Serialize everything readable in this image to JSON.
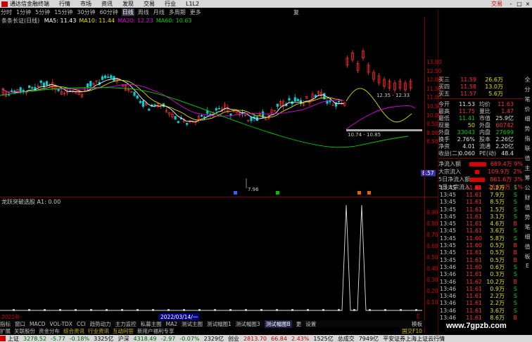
{
  "menubar": {
    "app_title": "通达信金融终端",
    "items": [
      "行情",
      "市场",
      "资讯",
      "发现",
      "交易",
      "行业",
      "L1L2"
    ],
    "trade_label": "交易",
    "window_buttons": [
      "-",
      "□",
      "×"
    ]
  },
  "periodbar": {
    "tabs": [
      "分时",
      "1分钟",
      "5分钟",
      "15分钟",
      "30分钟",
      "60分钟",
      "日线",
      "周线",
      "月线",
      "多周期",
      "更多"
    ],
    "selected": "日线",
    "right_label": "复"
  },
  "ma_legend": {
    "title": "条条长证(日线)",
    "items": [
      {
        "label": "MA5: 11.43",
        "color": "#ffffff"
      },
      {
        "label": "MA10: 11.44",
        "color": "#e0e000"
      },
      {
        "label": "MA20: 12.23",
        "color": "#e000e0"
      },
      {
        "label": "MA60: 10.63",
        "color": "#00d000"
      }
    ]
  },
  "main_chart": {
    "annotations": {
      "high": "12.35 - 12.33",
      "mid": "10.74 - 10.85",
      "low": "7.96"
    },
    "price_label": "8.57"
  },
  "price_axis": [
    "13.00",
    "12.50",
    "12.00",
    "11.50",
    "11.00",
    "10.50",
    "10.00",
    "9.50",
    "9.00",
    "8.50"
  ],
  "sub_chart": {
    "title": "龙跃突破选股 A1: 0.00"
  },
  "sub_axis": [
    "0.90",
    "0.80",
    "0.70",
    "0.60",
    "0.50",
    "0.40",
    "0.30",
    "0.20",
    "0.10"
  ],
  "date_row": {
    "start": "2021年",
    "cursor_date": "2022/03/14/一",
    "marker": "E"
  },
  "indicator_tabs": [
    "指标",
    "窗口",
    "MACD",
    "VOL-TDX",
    "CCI",
    "趋势动力",
    "主力监控",
    "私募主图",
    "MA2",
    "测试主图",
    "测试幅图1",
    "测试幅图3",
    "测试幅图B",
    "更",
    "设置"
  ],
  "indicator_selected": "测试幅图B",
  "indicator_right": "模板",
  "bottom_tabs": [
    "扩展",
    "关联股份",
    "资金分布",
    "综合资讯",
    "行业资讯",
    "互动问答",
    "新用户福利专享"
  ],
  "bottom_highlight": [
    "综合资讯",
    "行业资讯",
    "互动问答"
  ],
  "bottom_tag": "国交F10",
  "quote": {
    "rows": [
      {
        "l": "买三",
        "v1": "11.59",
        "c1": "r",
        "v2": "26.6万",
        "c2": "y"
      },
      {
        "l": "买四",
        "v1": "11.58",
        "c1": "r",
        "v2": "13.0万",
        "c2": "y"
      },
      {
        "l": "买五",
        "v1": "11.57",
        "c1": "r",
        "v2": "5.6万",
        "c2": "y"
      }
    ],
    "stats": [
      {
        "l": "今开",
        "v1": "11.53",
        "c1": "w",
        "l2": "均价",
        "v2": "11.63",
        "c2": "r"
      },
      {
        "l": "最高",
        "v1": "11.75",
        "c1": "r",
        "l2": "量比",
        "v2": "1.47",
        "c2": "r"
      },
      {
        "l": "最低",
        "v1": "11.41",
        "c1": "g",
        "l2": "市值",
        "v2": "25.9亿",
        "c2": "w"
      },
      {
        "l": "现量",
        "v1": "50",
        "c1": "y",
        "l2": "外盘",
        "v2": "60742",
        "c2": "r"
      },
      {
        "l": "外盘",
        "v1": "33043",
        "c1": "g",
        "l2": "内盘",
        "v2": "27699",
        "c2": "g"
      },
      {
        "l": "换手",
        "v1": "2.76%",
        "c1": "w",
        "l2": "股本",
        "v2": "2.26亿",
        "c2": "w"
      },
      {
        "l": "净资",
        "v1": "4.01",
        "c1": "w",
        "l2": "流通",
        "v2": "2.20亿",
        "c2": "w"
      },
      {
        "l": "收益(二)",
        "v1": "0.060",
        "c1": "w",
        "l2": "PE(动)",
        "v2": "48.4",
        "c2": "w"
      }
    ],
    "flows": [
      {
        "l": "净流入额",
        "bar": 28,
        "v": "689.4万",
        "p": "9%"
      },
      {
        "l": "大宗流入",
        "bar": 6,
        "v": "109.9万",
        "p": "2%"
      },
      {
        "l": "5日净流入额",
        "bar": 24,
        "v": "861.6万",
        "p": "3%"
      },
      {
        "l": "5日大宗流入",
        "bar": 8,
        "v": "216.0万",
        "p": "1%"
      }
    ]
  },
  "ticks": [
    {
      "t": "13:45",
      "p": "11.61",
      "q": "2.2万",
      "s": "S"
    },
    {
      "t": "13:45",
      "p": "11.61",
      "q": "7.9万",
      "s": "S"
    },
    {
      "t": "13:45",
      "p": "11.61",
      "q": "8.5万",
      "s": "S"
    },
    {
      "t": "13:45",
      "p": "11.61",
      "q": "1.5万",
      "s": "S"
    },
    {
      "t": "13:45",
      "p": "11.61",
      "q": "3.1万",
      "s": "S"
    },
    {
      "t": "13:45",
      "p": "11.61",
      "q": "4.6万",
      "s": "B"
    },
    {
      "t": "13:45",
      "p": "11.61",
      "q": "3.6万",
      "s": "S"
    },
    {
      "t": "13:45",
      "p": "11.60",
      "q": "5.8万",
      "s": "S"
    },
    {
      "t": "13:45",
      "p": "11.60",
      "q": "0.5万",
      "s": "B"
    },
    {
      "t": "13:45",
      "p": "11.61",
      "q": "0.5万",
      "s": "B"
    },
    {
      "t": "13:45",
      "p": "11.61",
      "q": "0.5万",
      "s": "B"
    },
    {
      "t": "13:46",
      "p": "11.60",
      "q": "0.6万",
      "s": "S"
    },
    {
      "t": "13:46",
      "p": "11.61",
      "q": "0.3万",
      "s": "S"
    },
    {
      "t": "13:46",
      "p": "11.62",
      "q": "10.2万",
      "s": "B"
    },
    {
      "t": "13:46",
      "p": "11.61",
      "q": "0.9万",
      "s": "S"
    },
    {
      "t": "13:46",
      "p": "11.61",
      "q": "2.2万",
      "s": "S"
    },
    {
      "t": "13:46",
      "p": "11.61",
      "q": "2.2万",
      "s": "S"
    },
    {
      "t": "13:46",
      "p": "11.61",
      "q": "3.6万",
      "s": "S"
    },
    {
      "t": "13:46",
      "p": "11.61",
      "q": "8.6万",
      "s": "B"
    }
  ],
  "sidebar": [
    "全",
    "分",
    "笔",
    "价",
    "细",
    "势",
    "指",
    "联",
    "值",
    "主",
    "筹",
    "公",
    "财",
    "值",
    "势",
    "笔",
    "细",
    "值",
    "板",
    "E"
  ],
  "status": {
    "items": [
      {
        "name": "上证",
        "price": "3278.52",
        "chg": "-5.77",
        "pct": "-0.18%",
        "vol": "3325亿",
        "dir": "dn"
      },
      {
        "name": "沪深",
        "price": "4318.49",
        "chg": "-2.97",
        "pct": "-0.07%",
        "vol": "2329亿",
        "dir": "dn"
      },
      {
        "name": "创业",
        "price": "2813.70",
        "chg": "66.84",
        "pct": "2.43%",
        "vol": "1525亿",
        "dir": "up"
      }
    ],
    "extra": [
      "总成交",
      "7949亿"
    ],
    "broker": "平安证券上海上证云行情"
  },
  "watermark": "www.7gpzb.com",
  "colors": {
    "up": "#ff3030",
    "down": "#00d0d0",
    "ma5": "#ffffff",
    "ma10": "#e0e000",
    "ma20": "#e000e0",
    "ma60": "#00d000"
  }
}
